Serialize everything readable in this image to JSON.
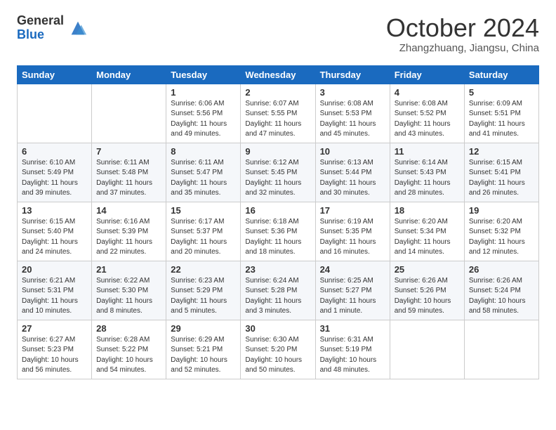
{
  "logo": {
    "general": "General",
    "blue": "Blue"
  },
  "header": {
    "month": "October 2024",
    "location": "Zhangzhuang, Jiangsu, China"
  },
  "weekdays": [
    "Sunday",
    "Monday",
    "Tuesday",
    "Wednesday",
    "Thursday",
    "Friday",
    "Saturday"
  ],
  "weeks": [
    [
      {
        "day": "",
        "info": ""
      },
      {
        "day": "",
        "info": ""
      },
      {
        "day": "1",
        "info": "Sunrise: 6:06 AM\nSunset: 5:56 PM\nDaylight: 11 hours and 49 minutes."
      },
      {
        "day": "2",
        "info": "Sunrise: 6:07 AM\nSunset: 5:55 PM\nDaylight: 11 hours and 47 minutes."
      },
      {
        "day": "3",
        "info": "Sunrise: 6:08 AM\nSunset: 5:53 PM\nDaylight: 11 hours and 45 minutes."
      },
      {
        "day": "4",
        "info": "Sunrise: 6:08 AM\nSunset: 5:52 PM\nDaylight: 11 hours and 43 minutes."
      },
      {
        "day": "5",
        "info": "Sunrise: 6:09 AM\nSunset: 5:51 PM\nDaylight: 11 hours and 41 minutes."
      }
    ],
    [
      {
        "day": "6",
        "info": "Sunrise: 6:10 AM\nSunset: 5:49 PM\nDaylight: 11 hours and 39 minutes."
      },
      {
        "day": "7",
        "info": "Sunrise: 6:11 AM\nSunset: 5:48 PM\nDaylight: 11 hours and 37 minutes."
      },
      {
        "day": "8",
        "info": "Sunrise: 6:11 AM\nSunset: 5:47 PM\nDaylight: 11 hours and 35 minutes."
      },
      {
        "day": "9",
        "info": "Sunrise: 6:12 AM\nSunset: 5:45 PM\nDaylight: 11 hours and 32 minutes."
      },
      {
        "day": "10",
        "info": "Sunrise: 6:13 AM\nSunset: 5:44 PM\nDaylight: 11 hours and 30 minutes."
      },
      {
        "day": "11",
        "info": "Sunrise: 6:14 AM\nSunset: 5:43 PM\nDaylight: 11 hours and 28 minutes."
      },
      {
        "day": "12",
        "info": "Sunrise: 6:15 AM\nSunset: 5:41 PM\nDaylight: 11 hours and 26 minutes."
      }
    ],
    [
      {
        "day": "13",
        "info": "Sunrise: 6:15 AM\nSunset: 5:40 PM\nDaylight: 11 hours and 24 minutes."
      },
      {
        "day": "14",
        "info": "Sunrise: 6:16 AM\nSunset: 5:39 PM\nDaylight: 11 hours and 22 minutes."
      },
      {
        "day": "15",
        "info": "Sunrise: 6:17 AM\nSunset: 5:37 PM\nDaylight: 11 hours and 20 minutes."
      },
      {
        "day": "16",
        "info": "Sunrise: 6:18 AM\nSunset: 5:36 PM\nDaylight: 11 hours and 18 minutes."
      },
      {
        "day": "17",
        "info": "Sunrise: 6:19 AM\nSunset: 5:35 PM\nDaylight: 11 hours and 16 minutes."
      },
      {
        "day": "18",
        "info": "Sunrise: 6:20 AM\nSunset: 5:34 PM\nDaylight: 11 hours and 14 minutes."
      },
      {
        "day": "19",
        "info": "Sunrise: 6:20 AM\nSunset: 5:32 PM\nDaylight: 11 hours and 12 minutes."
      }
    ],
    [
      {
        "day": "20",
        "info": "Sunrise: 6:21 AM\nSunset: 5:31 PM\nDaylight: 11 hours and 10 minutes."
      },
      {
        "day": "21",
        "info": "Sunrise: 6:22 AM\nSunset: 5:30 PM\nDaylight: 11 hours and 8 minutes."
      },
      {
        "day": "22",
        "info": "Sunrise: 6:23 AM\nSunset: 5:29 PM\nDaylight: 11 hours and 5 minutes."
      },
      {
        "day": "23",
        "info": "Sunrise: 6:24 AM\nSunset: 5:28 PM\nDaylight: 11 hours and 3 minutes."
      },
      {
        "day": "24",
        "info": "Sunrise: 6:25 AM\nSunset: 5:27 PM\nDaylight: 11 hours and 1 minute."
      },
      {
        "day": "25",
        "info": "Sunrise: 6:26 AM\nSunset: 5:26 PM\nDaylight: 10 hours and 59 minutes."
      },
      {
        "day": "26",
        "info": "Sunrise: 6:26 AM\nSunset: 5:24 PM\nDaylight: 10 hours and 58 minutes."
      }
    ],
    [
      {
        "day": "27",
        "info": "Sunrise: 6:27 AM\nSunset: 5:23 PM\nDaylight: 10 hours and 56 minutes."
      },
      {
        "day": "28",
        "info": "Sunrise: 6:28 AM\nSunset: 5:22 PM\nDaylight: 10 hours and 54 minutes."
      },
      {
        "day": "29",
        "info": "Sunrise: 6:29 AM\nSunset: 5:21 PM\nDaylight: 10 hours and 52 minutes."
      },
      {
        "day": "30",
        "info": "Sunrise: 6:30 AM\nSunset: 5:20 PM\nDaylight: 10 hours and 50 minutes."
      },
      {
        "day": "31",
        "info": "Sunrise: 6:31 AM\nSunset: 5:19 PM\nDaylight: 10 hours and 48 minutes."
      },
      {
        "day": "",
        "info": ""
      },
      {
        "day": "",
        "info": ""
      }
    ]
  ]
}
